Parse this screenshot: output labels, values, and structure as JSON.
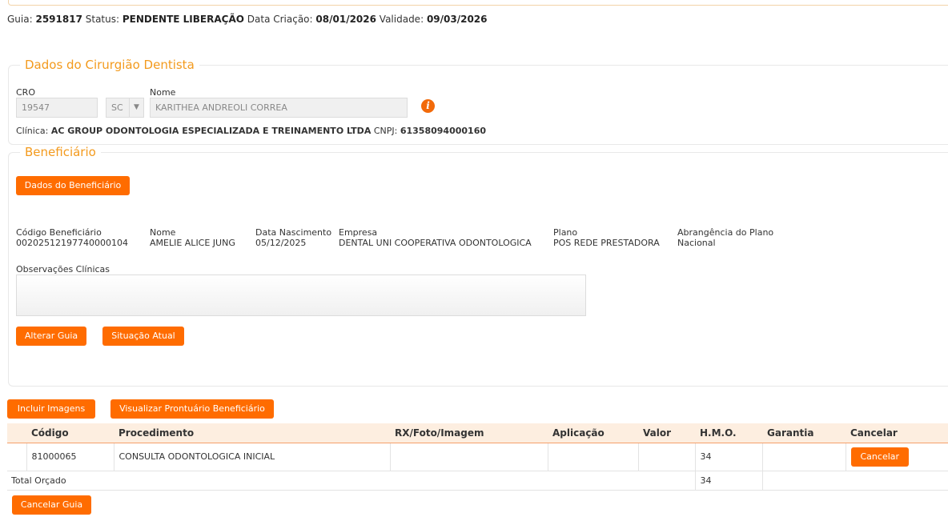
{
  "header": {
    "guia_label": "Guia:",
    "guia_value": "2591817",
    "status_label": "Status:",
    "status_value": "PENDENTE LIBERAÇÃO",
    "criacao_label": "Data Criação:",
    "criacao_value": "08/01/2026",
    "validade_label": "Validade:",
    "validade_value": "09/03/2026"
  },
  "dentist": {
    "legend": "Dados do Cirurgião Dentista",
    "cro_label": "CRO",
    "cro_value": "19547",
    "uf_value": "SC",
    "nome_label": "Nome",
    "nome_value": "KARITHEA ANDREOLI CORREA",
    "info_icon": "i",
    "clinica_label": "Clínica:",
    "clinica_value": "AC GROUP ODONTOLOGIA ESPECIALIZADA E TREINAMENTO LTDA",
    "cnpj_label": "CNPJ:",
    "cnpj_value": "61358094000160"
  },
  "beneficiary": {
    "legend": "Beneficiário",
    "dados_button": "Dados do Beneficiário",
    "fields": [
      {
        "label": "Código Beneficiário",
        "value": "00202512197740000104"
      },
      {
        "label": "Nome",
        "value": "AMELIE ALICE JUNG"
      },
      {
        "label": "Data Nascimento",
        "value": "05/12/2025"
      },
      {
        "label": "Empresa",
        "value": "DENTAL UNI COOPERATIVA ODONTOLOGICA"
      },
      {
        "label": "Plano",
        "value": "POS REDE PRESTADORA"
      },
      {
        "label": "Abrangência do Plano",
        "value": "Nacional"
      }
    ],
    "obs_label": "Observações Clínicas",
    "obs_value": "",
    "alterar_button": "Alterar Guia",
    "situacao_button": "Situação Atual"
  },
  "actions": {
    "incluir_button": "Incluir Imagens",
    "prontuario_button": "Visualizar Prontuário Beneficiário",
    "cancelar_guia_button": "Cancelar Guia"
  },
  "table": {
    "headers": [
      "",
      "Código",
      "Procedimento",
      "RX/Foto/Imagem",
      "Aplicação",
      "Valor",
      "H.M.O.",
      "Garantia",
      "Cancelar"
    ],
    "rows": [
      {
        "codigo": "81000065",
        "procedimento": "CONSULTA ODONTOLOGICA INICIAL",
        "rx": "",
        "aplicacao": "",
        "valor": "",
        "hmo": "34",
        "garantia": "",
        "cancel_label": "Cancelar"
      }
    ],
    "total_label": "Total Orçado",
    "total_hmo": "34"
  },
  "colors": {
    "accent": "#ff6c00",
    "legend": "#f39a1d",
    "table_header_bg": "#fdeee0"
  }
}
